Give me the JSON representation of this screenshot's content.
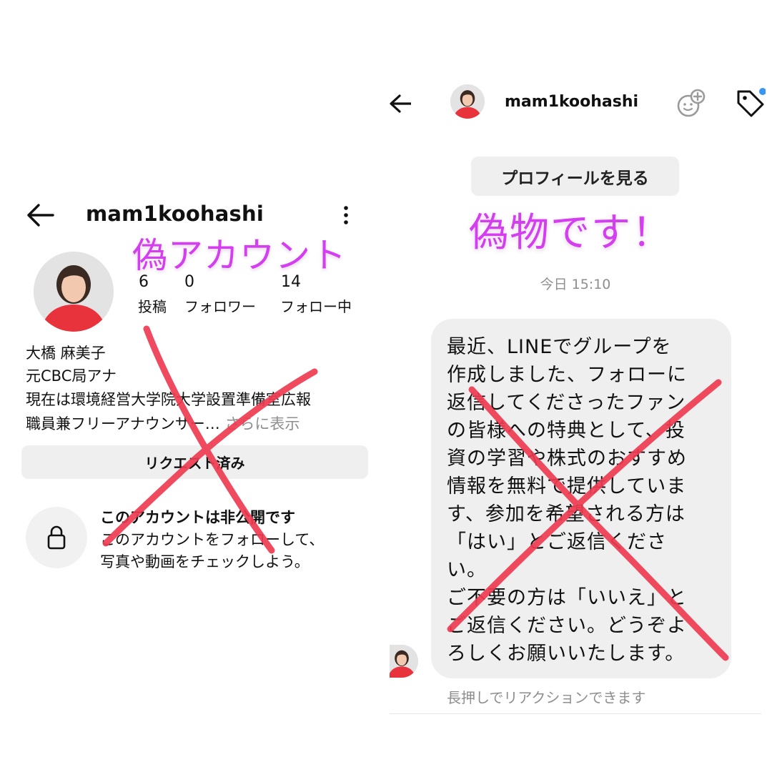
{
  "profile_screen": {
    "username": "mam1koohashi",
    "fake_label": "偽アカウント",
    "stats": [
      {
        "value": "6",
        "label": "投稿"
      },
      {
        "value": "0",
        "label": "フォロワー"
      },
      {
        "value": "14",
        "label": "フォロー中"
      }
    ],
    "bio": {
      "name": "大橋 麻美子",
      "line1": "元CBC局アナ",
      "line2": "現在は環境経営大学院大学設置準備室広報",
      "line3": "職員兼フリーアナウンサー…",
      "see_more": "さらに表示"
    },
    "request_button": "リクエスト済み",
    "private": {
      "title": "このアカウントは非公開です",
      "desc_line1": "このアカウントをフォローして、",
      "desc_line2": "写真や動画をチェックしよう。"
    },
    "icons": {
      "back": "back-arrow-icon",
      "more": "more-vertical-icon",
      "lock": "lock-icon"
    }
  },
  "dm_screen": {
    "username": "mam1koohashi",
    "view_profile_button": "プロフィールを見る",
    "fake_label": "偽物です！",
    "timestamp": "今日 15:10",
    "message_lines": [
      "最近、LINEでグループを",
      "作成しました、フォローに",
      "返信してくださったファン",
      "の皆様への特典として、投",
      "資の学習や株式のおすすめ",
      "情報を無料で提供していま",
      "す、参加を希望される方は",
      "「はい」とご返信くださ",
      "い。",
      "ご不要の方は「いいえ」と",
      "ご返信ください。どうぞよ",
      "ろしくお願いいたします。"
    ],
    "reaction_hint": "長押しでリアクションできます",
    "icons": {
      "back": "back-arrow-icon",
      "effects": "face-effects-icon",
      "tag": "tag-icon"
    }
  },
  "colors": {
    "fake_label": "#d43df0",
    "cross_mark": "#ef3b52",
    "button_bg": "#efefef",
    "muted_text": "#8e8e8e",
    "avatar_outfit": "#e8323c"
  }
}
